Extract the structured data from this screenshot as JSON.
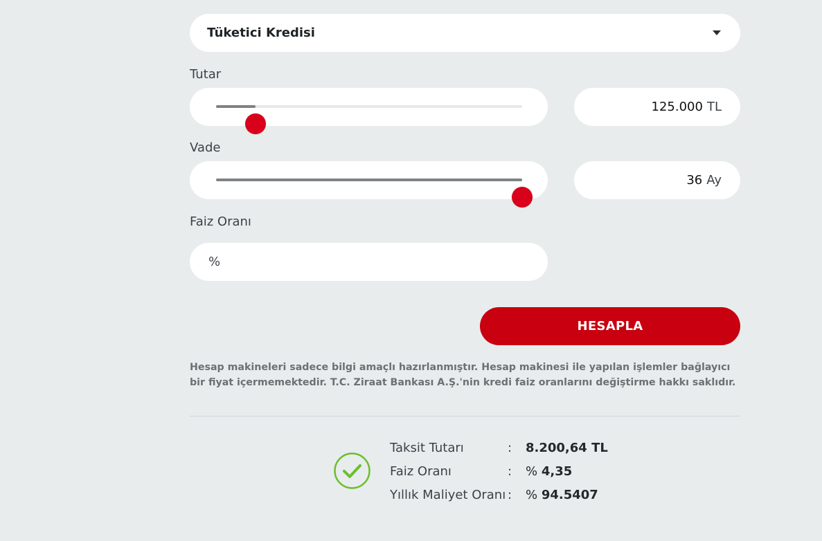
{
  "loan_type": {
    "selected": "Tüketici Kredisi"
  },
  "amount": {
    "label": "Tutar",
    "value": "125.000",
    "unit": "TL",
    "slider_fraction": 0.13
  },
  "term": {
    "label": "Vade",
    "value": "36",
    "unit": "Ay",
    "slider_fraction": 1.0
  },
  "interest": {
    "label": "Faiz Oranı",
    "prefix": "%",
    "value": ""
  },
  "calculate_button": "HESAPLA",
  "disclaimer": "Hesap makineleri sadece bilgi amaçlı hazırlanmıştır. Hesap makinesi ile yapılan işlemler bağlayıcı bir fiyat içermemektedir. T.C. Ziraat Bankası A.Ş.'nin kredi faiz oranlarını değiştirme hakkı saklıdır.",
  "results": [
    {
      "label": "Taksit Tutarı",
      "prefix": "",
      "value": "8.200,64 TL"
    },
    {
      "label": "Faiz Oranı",
      "prefix": "%",
      "value": "4,35"
    },
    {
      "label": "Yıllık Maliyet Oranı",
      "prefix": "%",
      "value": "94.5407"
    }
  ],
  "colors": {
    "accent": "#c8000f",
    "slider_thumb": "#d8001b",
    "success": "#6abf2c",
    "background": "#e8eced"
  },
  "icons": {
    "dropdown": "caret-down-icon",
    "result": "check-circle-icon"
  }
}
